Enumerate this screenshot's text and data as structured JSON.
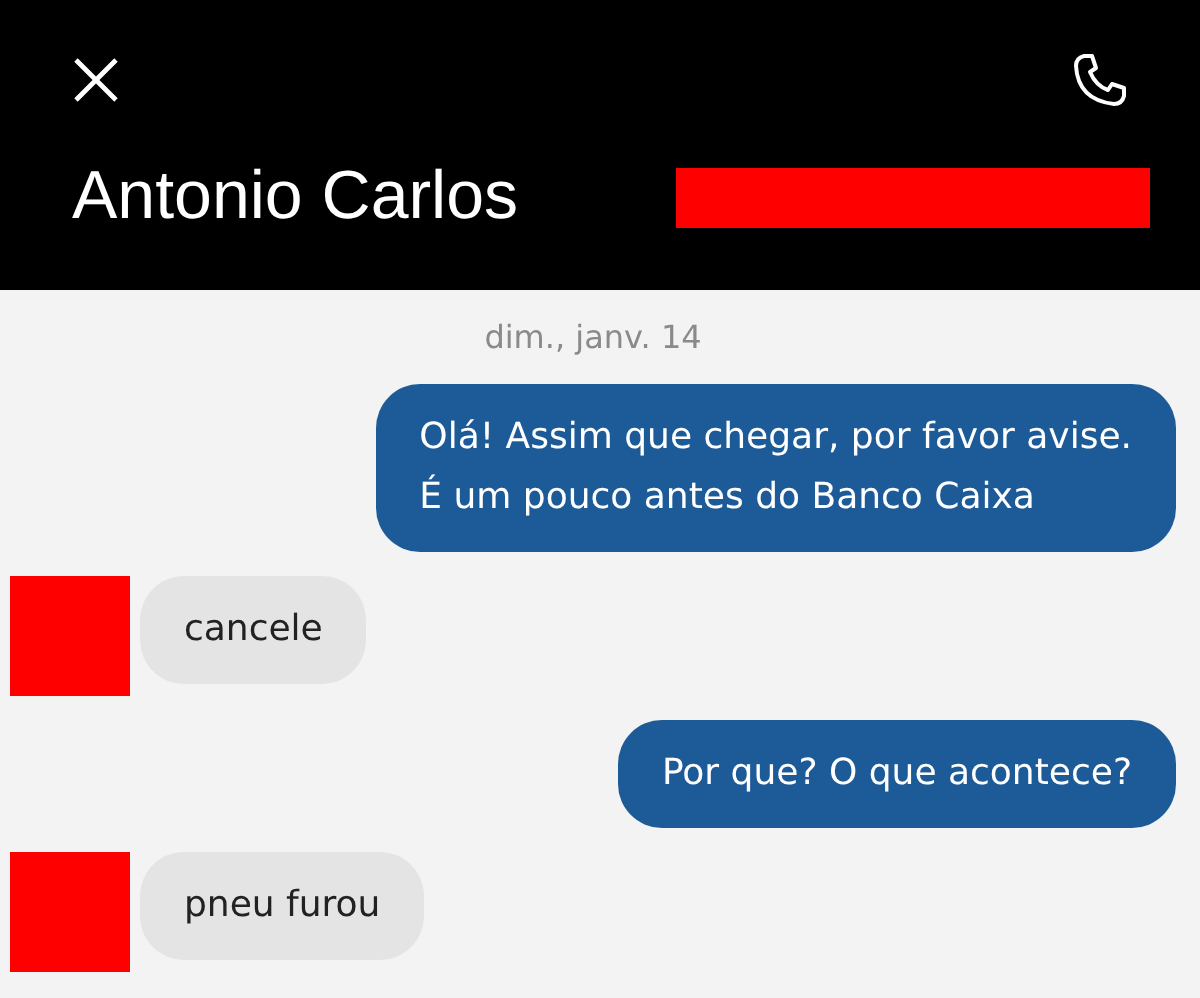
{
  "header": {
    "title": "Antonio Carlos"
  },
  "date_divider": "dim., janv. 14",
  "messages": [
    {
      "kind": "sent",
      "text": "Olá! Assim que chegar, por favor avise.\nÉ um pouco antes do Banco Caixa"
    },
    {
      "kind": "received",
      "text": "cancele"
    },
    {
      "kind": "sent",
      "text": "Por que? O que acontece?"
    },
    {
      "kind": "received",
      "text": "pneu furou"
    }
  ]
}
